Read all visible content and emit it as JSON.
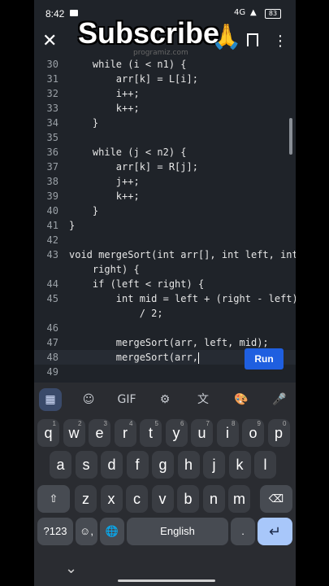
{
  "status": {
    "time": "8:42",
    "network": "4G",
    "battery": "83"
  },
  "appbar": {
    "close": "✕",
    "overlay_title": "Subscribe",
    "overlay_emoji": "🙏",
    "more": "⋮",
    "faint_title": "programiz.com"
  },
  "code": {
    "lines": [
      {
        "n": "30",
        "t": "    while (i < n1) {"
      },
      {
        "n": "31",
        "t": "        arr[k] = L[i];"
      },
      {
        "n": "32",
        "t": "        i++;"
      },
      {
        "n": "33",
        "t": "        k++;"
      },
      {
        "n": "34",
        "t": "    }"
      },
      {
        "n": "35",
        "t": ""
      },
      {
        "n": "36",
        "t": "    while (j < n2) {"
      },
      {
        "n": "37",
        "t": "        arr[k] = R[j];"
      },
      {
        "n": "38",
        "t": "        j++;"
      },
      {
        "n": "39",
        "t": "        k++;"
      },
      {
        "n": "40",
        "t": "    }"
      },
      {
        "n": "41",
        "t": "}"
      },
      {
        "n": "42",
        "t": ""
      },
      {
        "n": "43",
        "t": "void mergeSort(int arr[], int left, int"
      },
      {
        "n": "",
        "t": "    right) {"
      },
      {
        "n": "44",
        "t": "    if (left < right) {"
      },
      {
        "n": "45",
        "t": "        int mid = left + (right - left)"
      },
      {
        "n": "",
        "t": "            / 2;"
      },
      {
        "n": "46",
        "t": ""
      },
      {
        "n": "47",
        "t": "        mergeSort(arr, left, mid);"
      },
      {
        "n": "48",
        "t": "        mergeSort(arr,"
      },
      {
        "n": "49",
        "t": ""
      }
    ]
  },
  "run_label": "Run",
  "keyboard": {
    "tools": [
      "▦",
      "☺",
      "GIF",
      "⚙",
      "文",
      "🎨",
      "🎤"
    ],
    "row1": [
      [
        "q",
        "1"
      ],
      [
        "w",
        "2"
      ],
      [
        "e",
        "3"
      ],
      [
        "r",
        "4"
      ],
      [
        "t",
        "5"
      ],
      [
        "y",
        "6"
      ],
      [
        "u",
        "7"
      ],
      [
        "i",
        "8"
      ],
      [
        "o",
        "9"
      ],
      [
        "p",
        "0"
      ]
    ],
    "row2": [
      "a",
      "s",
      "d",
      "f",
      "g",
      "h",
      "j",
      "k",
      "l"
    ],
    "row3": [
      "z",
      "x",
      "c",
      "v",
      "b",
      "n",
      "m"
    ],
    "shift": "⇧",
    "backspace": "⌫",
    "symbols": "?123",
    "emoji": "☺",
    "comma": ",",
    "globe": "🌐",
    "space": "English",
    "period": ".",
    "enter": "↵"
  },
  "nav": {
    "chevron": "⌄"
  }
}
